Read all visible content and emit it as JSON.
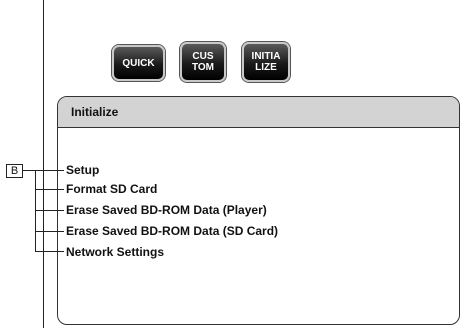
{
  "mode_buttons": {
    "quick": "QUICK",
    "custom": "CUS\nTOM",
    "initialize": "INITIA\nLIZE"
  },
  "menu": {
    "title": "Initialize",
    "items": [
      "Setup",
      "Format SD Card",
      "Erase Saved BD-ROM Data (Player)",
      "Erase Saved BD-ROM Data (SD Card)",
      "Network Settings"
    ]
  },
  "callout": {
    "label": "B"
  }
}
